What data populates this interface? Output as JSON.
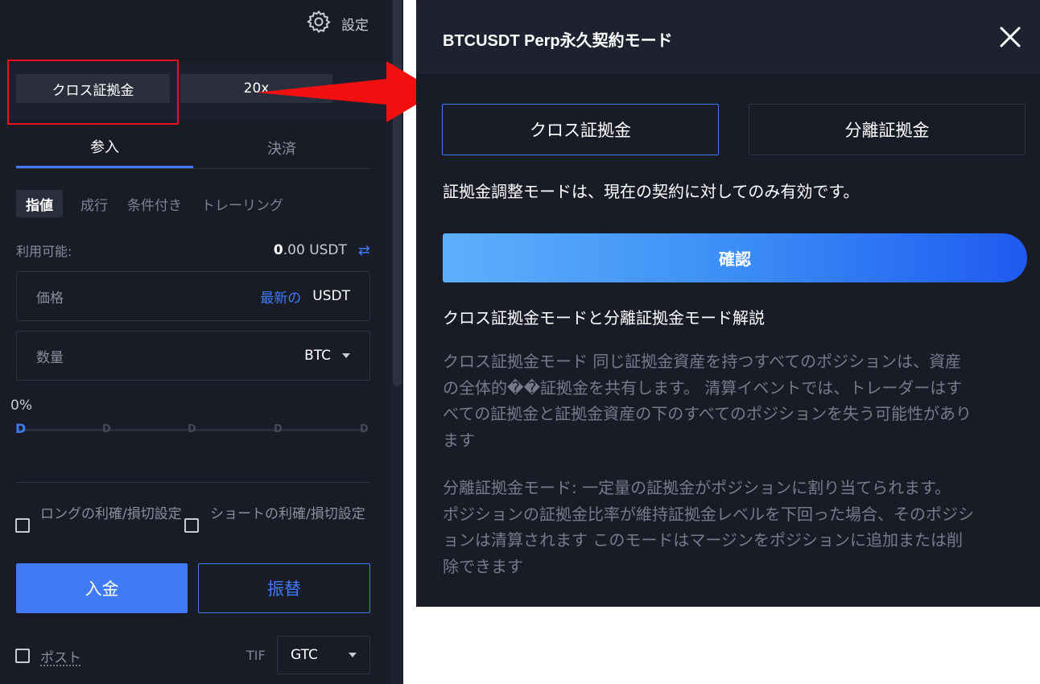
{
  "left_panel": {
    "settings_label": "設定",
    "margin_mode_label": "クロス証拠金",
    "leverage_label": "20x",
    "tabs": [
      {
        "label": "参入"
      },
      {
        "label": "決済"
      }
    ],
    "order_types": [
      {
        "label": "指値"
      },
      {
        "label": "成行"
      },
      {
        "label": "条件付き"
      },
      {
        "label": "トレーリング"
      }
    ],
    "available_label": "利用可能:",
    "available_value_int": "0",
    "available_value_rest": ".00 USDT",
    "price": {
      "label": "価格",
      "latest": "最新の",
      "unit": "USDT"
    },
    "quantity": {
      "label": "数量",
      "unit": "BTC"
    },
    "slider": {
      "percent_label": "0%",
      "marks": [
        "D",
        "D",
        "D",
        "D",
        "D"
      ],
      "value_percent": 0
    },
    "long_tpsl_label": "ロングの利確/損切設定",
    "short_tpsl_label": "ショートの利確/損切設定",
    "deposit_label": "入金",
    "transfer_label": "振替",
    "post_label": "ポスト",
    "tif_label": "TIF",
    "tif_value": "GTC"
  },
  "modal": {
    "title": "BTCUSDT Perp永久契約モード",
    "modes": [
      {
        "label": "クロス証拠金",
        "selected": true
      },
      {
        "label": "分離証拠金",
        "selected": false
      }
    ],
    "note": "証拠金調整モードは、現在の契約に対してのみ有効です。",
    "confirm_label": "確認",
    "explain_title": "クロス証拠金モードと分離証拠金モード解説",
    "cross_lines": [
      "クロス証拠金モード 同じ証拠金資産を持つすべてのポジションは、資産",
      "の全体的��証拠金を共有します。 清算イベントでは、トレーダーはす",
      "べての証拠金と証拠金資産の下のすべてのポジションを失う可能性があり",
      "ます"
    ],
    "isolated_lines": [
      "分離証拠金モード: 一定量の証拠金がポジションに割り当てられます。",
      "ポジションの証拠金比率が維持証拠金レベルを下回った場合、そのポジシ",
      "ョンは清算されます このモードはマージンをポジションに追加または削",
      "除できます"
    ]
  },
  "colors": {
    "accent": "#3e7bf5",
    "panel_bg": "#191b27",
    "annotation_red": "#e8141c"
  }
}
